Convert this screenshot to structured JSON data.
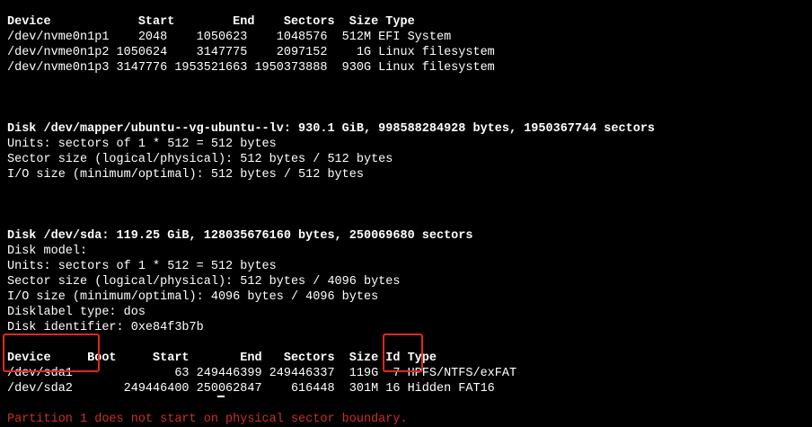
{
  "terminal": {
    "nvme_header": "Device            Start        End    Sectors  Size Type",
    "nvme_rows": [
      "/dev/nvme0n1p1    2048    1050623    1048576  512M EFI System",
      "/dev/nvme0n1p2 1050624    3147775    2097152    1G Linux filesystem",
      "/dev/nvme0n1p3 3147776 1953521663 1950373888  930G Linux filesystem"
    ],
    "mapper_disk": "Disk /dev/mapper/ubuntu--vg-ubuntu--lv: 930.1 GiB, 998588284928 bytes, 1950367744 sectors",
    "mapper_info": [
      "Units: sectors of 1 * 512 = 512 bytes",
      "Sector size (logical/physical): 512 bytes / 512 bytes",
      "I/O size (minimum/optimal): 512 bytes / 512 bytes"
    ],
    "sda_disk": "Disk /dev/sda: 119.25 GiB, 128035676160 bytes, 250069680 sectors",
    "sda_info": [
      "Disk model:",
      "Units: sectors of 1 * 512 = 512 bytes",
      "Sector size (logical/physical): 512 bytes / 4096 bytes",
      "I/O size (minimum/optimal): 4096 bytes / 4096 bytes",
      "Disklabel type: dos",
      "Disk identifier: 0xe84f3b7b"
    ],
    "sda_header": "Device     Boot     Start       End   Sectors  Size Id Type",
    "sda_rows": [
      "/dev/sda1              63 249446399 249446337  119G  7 HPFS/NTFS/exFAT",
      "/dev/sda2       249446400 250062847    616448  301M 16 Hidden FAT16"
    ],
    "warning": "Partition 1 does not start on physical sector boundary."
  },
  "colors": {
    "background": "#000000",
    "text": "#ffffff",
    "warning": "#cc2e2e",
    "highlight_box": "#e8261e"
  }
}
